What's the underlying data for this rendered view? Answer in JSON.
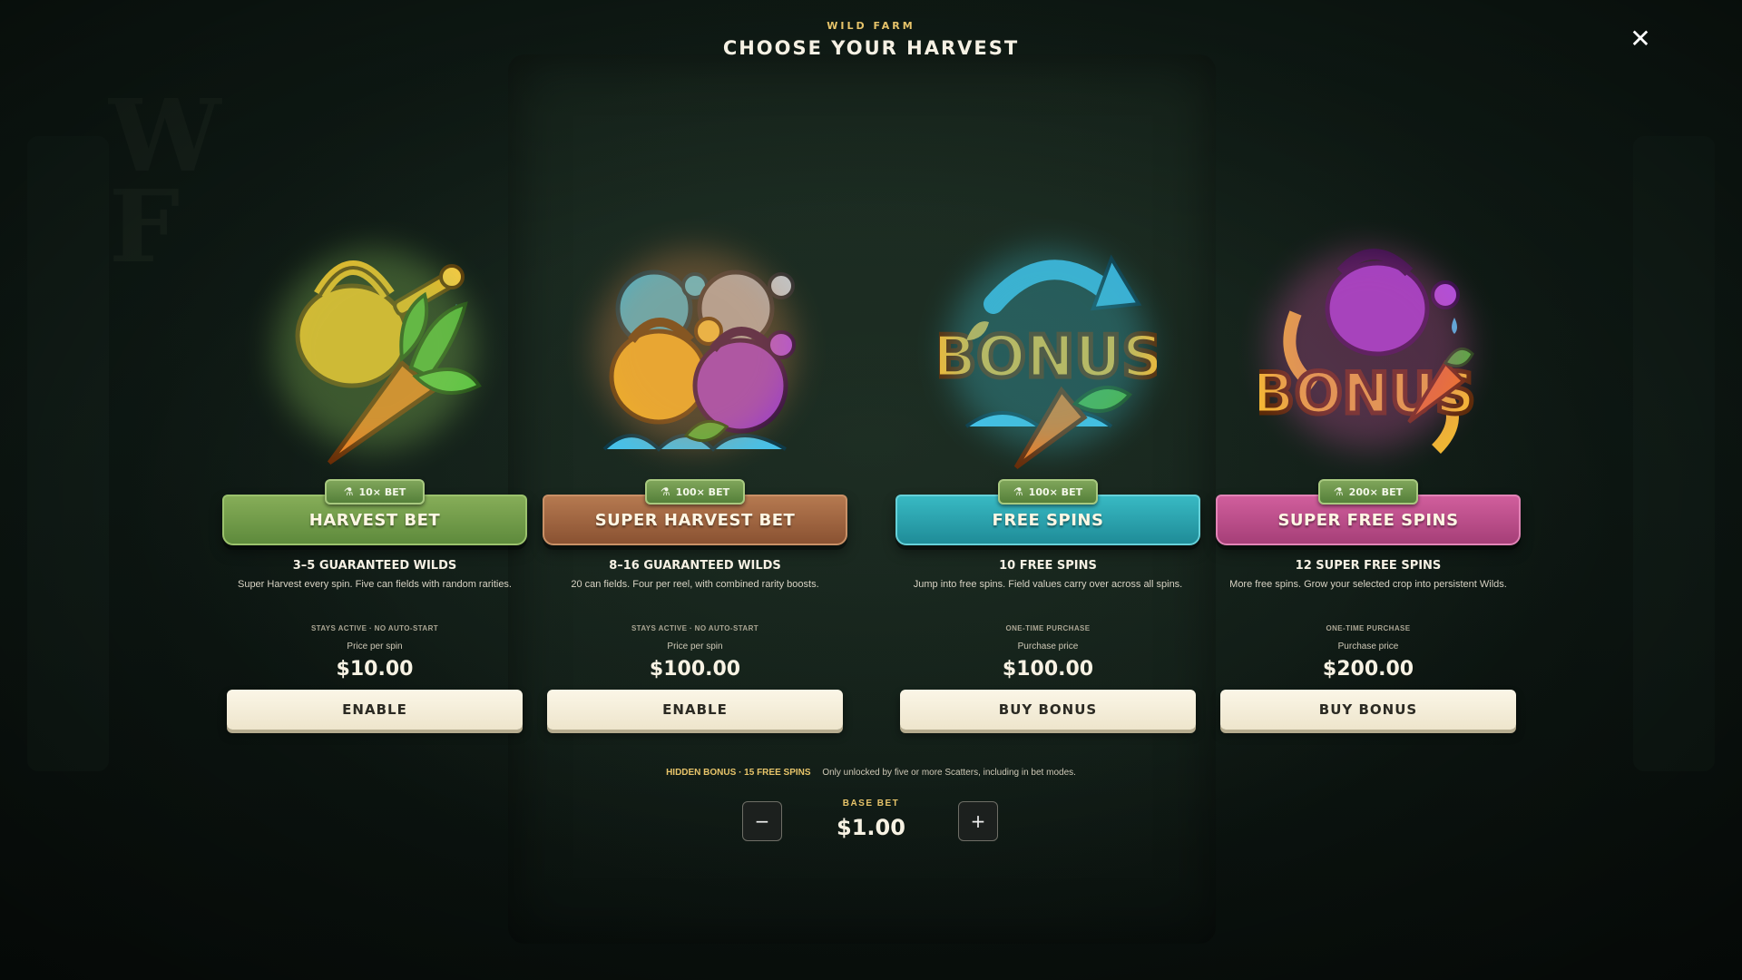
{
  "header": {
    "subtitle": "WILD FARM",
    "title": "CHOOSE YOUR HARVEST",
    "close_icon": "close-icon"
  },
  "cards": [
    {
      "badge": "10× BET",
      "badge_icon": "flask-icon",
      "name": "HARVEST BET",
      "banner_color": "#6f9a48",
      "art_icon": "watering-can-carrot-icon",
      "headline": "3–5 GUARANTEED WILDS",
      "description": "Super Harvest every spin. Five can fields with random rarities.",
      "note": "STAYS ACTIVE · NO AUTO-START",
      "price_label": "Price per spin",
      "price": "$10.00",
      "action": "ENABLE"
    },
    {
      "badge": "100× BET",
      "badge_icon": "flask-icon",
      "name": "SUPER HARVEST BET",
      "banner_color": "#a86a42",
      "art_icon": "watering-cans-icon",
      "headline": "8–16 GUARANTEED WILDS",
      "description": "20 can fields. Four per reel, with combined rarity boosts.",
      "note": "STAYS ACTIVE · NO AUTO-START",
      "price_label": "Price per spin",
      "price": "$100.00",
      "action": "ENABLE"
    },
    {
      "badge": "100× BET",
      "badge_icon": "flask-icon",
      "name": "FREE SPINS",
      "banner_color": "#2aa7b3",
      "art_icon": "bonus-carrot-icon",
      "headline": "10 FREE SPINS",
      "description": "Jump into free spins. Field values carry over across all spins.",
      "note": "ONE-TIME PURCHASE",
      "price_label": "Purchase price",
      "price": "$100.00",
      "action": "BUY BONUS"
    },
    {
      "badge": "200× BET",
      "badge_icon": "flask-icon",
      "name": "SUPER FREE SPINS",
      "banner_color": "#c14f8e",
      "art_icon": "bonus-purple-can-icon",
      "headline": "12 SUPER FREE SPINS",
      "description": "More free spins. Grow your selected crop into persistent Wilds.",
      "note": "ONE-TIME PURCHASE",
      "price_label": "Purchase price",
      "price": "$200.00",
      "action": "BUY BONUS"
    }
  ],
  "footer": {
    "hidden_bonus_title": "HIDDEN BONUS · 15 FREE SPINS",
    "hidden_bonus_text": "Only unlocked by five or more Scatters, including in bet modes.",
    "base_bet_label": "BASE BET",
    "base_bet_value": "$1.00",
    "decrease_label": "−",
    "increase_label": "+"
  }
}
